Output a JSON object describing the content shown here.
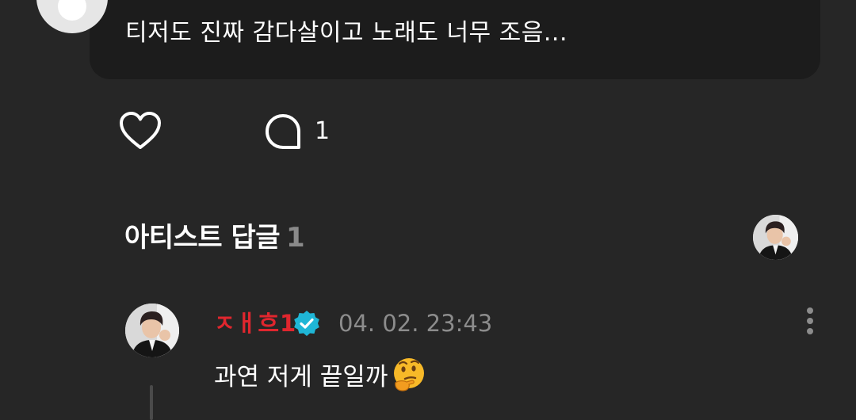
{
  "comment": {
    "text": "티저도 진짜 감다살이고 노래도 너무 조음..."
  },
  "actions": {
    "like_icon": "heart-outline-icon",
    "comment_icon": "speech-bubble-icon",
    "comment_count": "1"
  },
  "artist_replies": {
    "title": "아티스트 답글",
    "count": "1"
  },
  "reply": {
    "author": "ㅈㅐ흐1",
    "verified_icon": "verified-badge-icon",
    "timestamp": "04. 02. 23:43",
    "text": "과연 저게 끝일까",
    "emoji": "thinking-face-emoji",
    "more_icon": "more-vertical-icon"
  },
  "colors": {
    "background": "#262626",
    "bubble": "#1c1c1c",
    "author_name": "#e0262e",
    "verified": "#1fb6d6",
    "muted": "#8c8c8c"
  }
}
